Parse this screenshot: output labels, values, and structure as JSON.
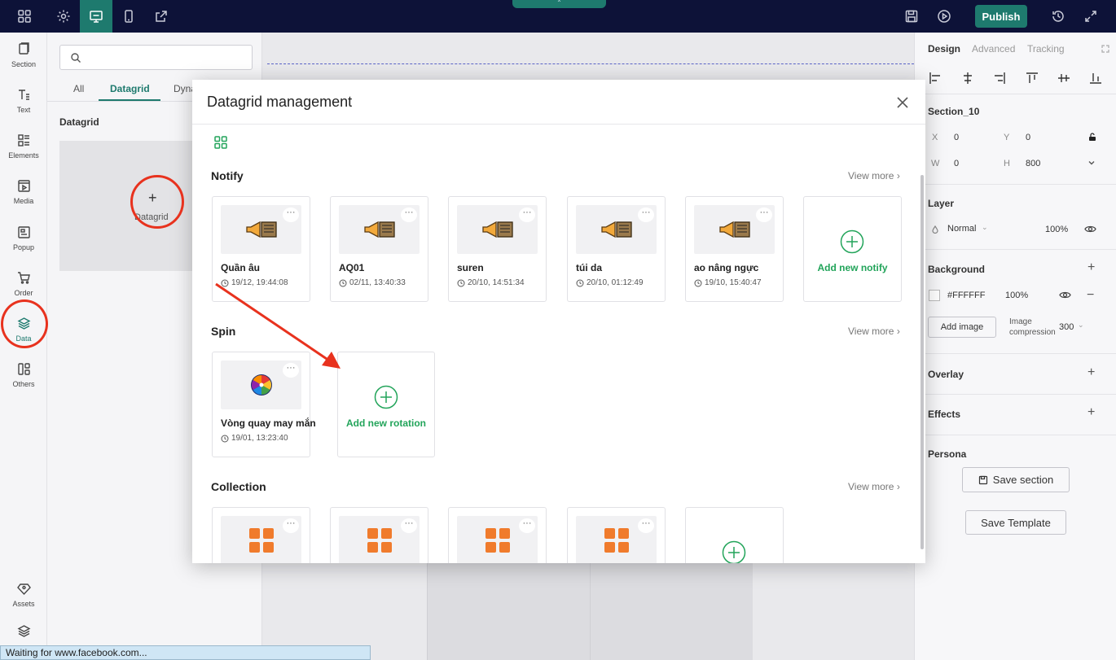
{
  "topbar": {
    "publish_label": "Publish",
    "notch_glyph": "⌃"
  },
  "rail": {
    "items": [
      {
        "label": "Section",
        "icon": "section-icon"
      },
      {
        "label": "Text",
        "icon": "text-icon"
      },
      {
        "label": "Elements",
        "icon": "elements-icon"
      },
      {
        "label": "Media",
        "icon": "media-icon"
      },
      {
        "label": "Popup",
        "icon": "popup-icon"
      },
      {
        "label": "Order",
        "icon": "cart-icon"
      },
      {
        "label": "Data",
        "icon": "layers-icon"
      },
      {
        "label": "Others",
        "icon": "others-icon"
      },
      {
        "label": "Assets",
        "icon": "diamond-icon"
      }
    ]
  },
  "panel": {
    "tabs": [
      "All",
      "Datagrid",
      "Dyna"
    ],
    "heading": "Datagrid",
    "tile_label": "Datagrid",
    "tile_plus": "+"
  },
  "rpanel": {
    "tabs": [
      "Design",
      "Advanced",
      "Tracking"
    ],
    "section_name": "Section_10",
    "x_label": "X",
    "x_value": "0",
    "y_label": "Y",
    "y_value": "0",
    "w_label": "W",
    "w_value": "0",
    "h_label": "H",
    "h_value": "800",
    "layer_heading": "Layer",
    "layer_mode": "Normal",
    "layer_opacity": "100%",
    "background_heading": "Background",
    "bg_color": "#FFFFFF",
    "bg_opacity": "100%",
    "add_image_label": "Add image",
    "image_compression_label": "Image compression",
    "image_compression_value": "300",
    "overlay_heading": "Overlay",
    "effects_heading": "Effects",
    "persona_heading": "Persona",
    "save_section_label": "Save section",
    "save_template_label": "Save Template"
  },
  "modal": {
    "title": "Datagrid management",
    "view_more": "View more",
    "sections": {
      "notify": {
        "title": "Notify",
        "cards": [
          {
            "name": "Quần âu",
            "time": "19/12, 19:44:08"
          },
          {
            "name": "AQ01",
            "time": "02/11, 13:40:33"
          },
          {
            "name": "suren",
            "time": "20/10, 14:51:34"
          },
          {
            "name": "túi da",
            "time": "20/10, 01:12:49"
          },
          {
            "name": "ao nâng ngực",
            "time": "19/10, 15:40:47"
          }
        ],
        "add_label": "Add new notify"
      },
      "spin": {
        "title": "Spin",
        "cards": [
          {
            "name": "Vòng quay may mắn",
            "time": "19/01, 13:23:40"
          }
        ],
        "add_label": "Add new rotation"
      },
      "collection": {
        "title": "Collection"
      }
    },
    "card_menu": "···"
  },
  "statusbar": {
    "text": "Waiting for www.facebook.com..."
  },
  "colors": {
    "topbar_bg": "#0d1238",
    "accent": "#1e7a6e",
    "add_green": "#22a45a",
    "annotation_red": "#e8321e"
  }
}
